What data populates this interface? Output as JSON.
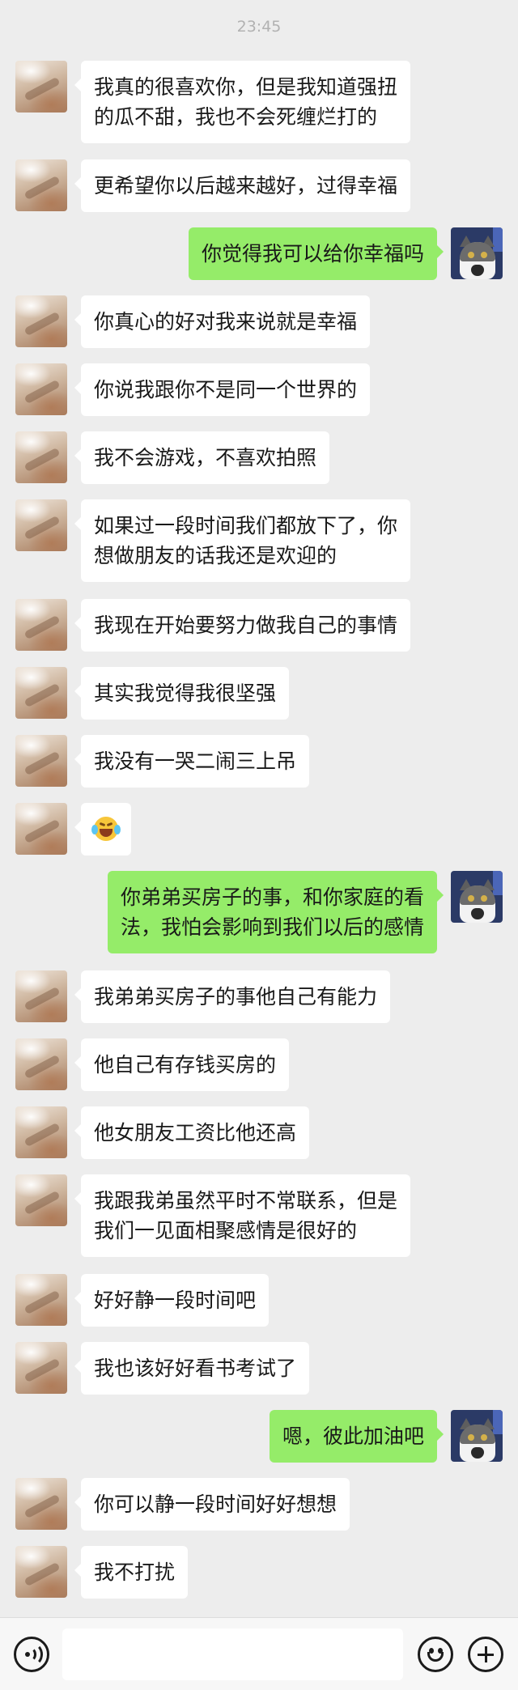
{
  "timestamp": "23:45",
  "messages": [
    {
      "side": "left",
      "text": "我真的很喜欢你，但是我知道强扭\n的瓜不甜，我也不会死缠烂打的"
    },
    {
      "side": "left",
      "text": "更希望你以后越来越好，过得幸福"
    },
    {
      "side": "right",
      "text": "你觉得我可以给你幸福吗"
    },
    {
      "side": "left",
      "text": "你真心的好对我来说就是幸福"
    },
    {
      "side": "left",
      "text": "你说我跟你不是同一个世界的"
    },
    {
      "side": "left",
      "text": "我不会游戏，不喜欢拍照"
    },
    {
      "side": "left",
      "text": "如果过一段时间我们都放下了，你\n想做朋友的话我还是欢迎的"
    },
    {
      "side": "left",
      "text": "我现在开始要努力做我自己的事情"
    },
    {
      "side": "left",
      "text": "其实我觉得我很坚强"
    },
    {
      "side": "left",
      "text": "我没有一哭二闹三上吊"
    },
    {
      "side": "left",
      "text": "",
      "emoji": "crying-laughing-emoji"
    },
    {
      "side": "right",
      "text": "你弟弟买房子的事，和你家庭的看\n法，我怕会影响到我们以后的感情"
    },
    {
      "side": "left",
      "text": "我弟弟买房子的事他自己有能力"
    },
    {
      "side": "left",
      "text": "他自己有存钱买房的"
    },
    {
      "side": "left",
      "text": "他女朋友工资比他还高"
    },
    {
      "side": "left",
      "text": "我跟我弟虽然平时不常联系，但是\n我们一见面相聚感情是很好的"
    },
    {
      "side": "left",
      "text": "好好静一段时间吧"
    },
    {
      "side": "left",
      "text": "我也该好好看书考试了"
    },
    {
      "side": "right",
      "text": "嗯，彼此加油吧"
    },
    {
      "side": "left",
      "text": "你可以静一段时间好好想想"
    },
    {
      "side": "left",
      "text": "我不打扰"
    }
  ],
  "input_bar": {
    "placeholder": "",
    "voice_icon": "voice-icon",
    "emoji_icon": "emoji-icon",
    "plus_icon": "plus-icon"
  },
  "colors": {
    "background": "#ededed",
    "incoming_bubble": "#ffffff",
    "outgoing_bubble": "#95ec69",
    "timestamp": "#b2b2b2"
  }
}
